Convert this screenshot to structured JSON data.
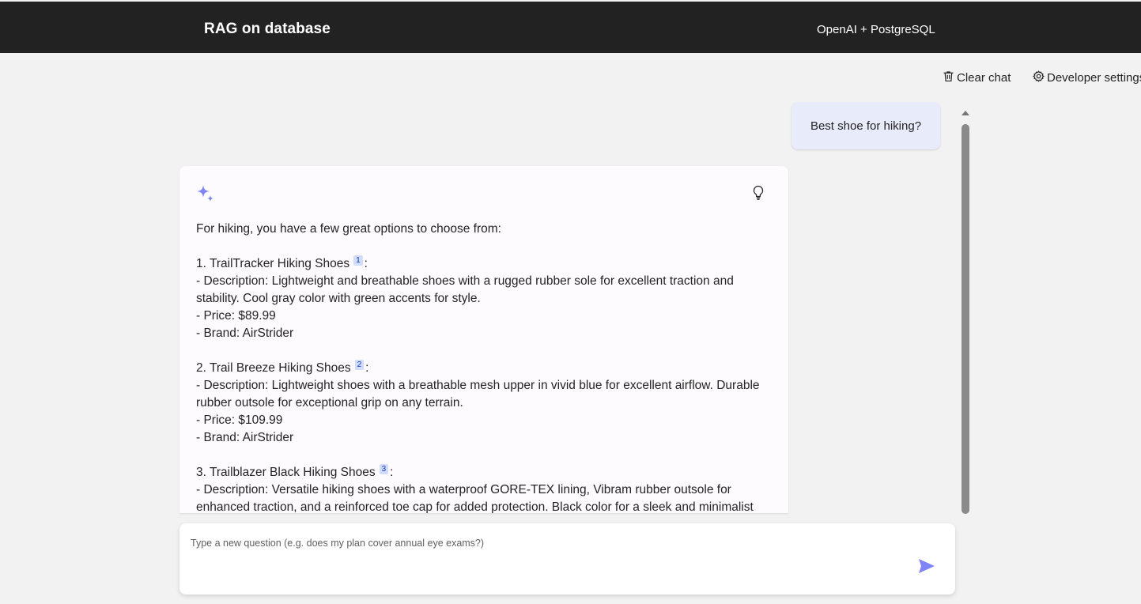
{
  "header": {
    "title": "RAG on database",
    "tagline": "OpenAI + PostgreSQL"
  },
  "commands": {
    "clear_chat": "Clear chat",
    "developer_settings": "Developer settings"
  },
  "chat": {
    "user_question": "Best shoe for hiking?",
    "answer": {
      "intro": "For hiking, you have a few great options to choose from:",
      "items": [
        {
          "heading": "1. TrailTracker Hiking Shoes",
          "citation": "1",
          "lines": [
            "- Description: Lightweight and breathable shoes with a rugged rubber sole for excellent traction and stability. Cool gray color with green accents for style.",
            "- Price: $89.99",
            "- Brand: AirStrider"
          ]
        },
        {
          "heading": "2. Trail Breeze Hiking Shoes",
          "citation": "2",
          "lines": [
            "- Description: Lightweight shoes with a breathable mesh upper in vivid blue for excellent airflow. Durable rubber outsole for exceptional grip on any terrain.",
            "- Price: $109.99",
            "- Brand: AirStrider"
          ]
        },
        {
          "heading": "3. Trailblazer Black Hiking Shoes",
          "citation": "3",
          "lines": [
            "- Description: Versatile hiking shoes with a waterproof GORE-TEX lining, Vibram rubber outsole for enhanced traction, and a reinforced toe cap for added protection. Black color for a sleek and minimalist"
          ]
        }
      ]
    }
  },
  "composer": {
    "placeholder": "Type a new question (e.g. does my plan cover annual eye exams?)"
  },
  "icons": {
    "clear_chat": "trash-icon",
    "developer_settings": "gear-icon",
    "answer_avatar": "sparkle-icon",
    "thought_process": "lightbulb-icon",
    "send": "send-icon"
  },
  "colors": {
    "header_bg": "#222222",
    "page_bg": "#f2f2f2",
    "user_bubble_bg": "#e8ebfa",
    "accent": "#7f85f5",
    "citation_bg": "#d1dbfa"
  }
}
